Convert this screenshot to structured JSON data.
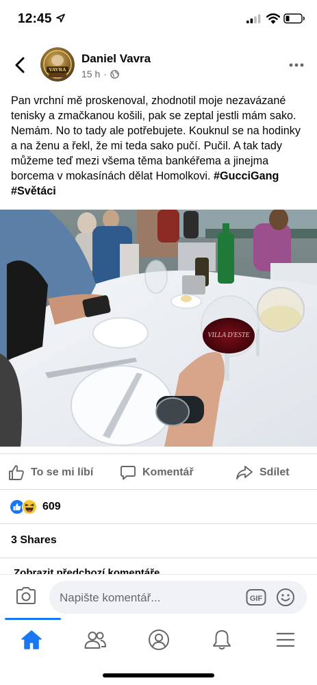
{
  "status_bar": {
    "time": "12:45"
  },
  "post": {
    "author": "Daniel Vavra",
    "avatar_text": "VAVRA",
    "time_ago": "15 h",
    "separator": "·",
    "body_text": "Pan vrchní mě proskenoval, zhodnotil moje nezavázané tenisky a zmačkanou košili, pak se zeptal jestli mám sako. Nemám. No to tady ale potřebujete. Kouknul se na hodinky a na ženu a řekl, že mi teda sako pučí. Pučil. A tak tady můžeme teď mezi všema těma bankéřema a jinejma borcema v mokasínách dělat Homolkovi.",
    "hashtags": [
      "#GucciGang",
      "#Světáci"
    ],
    "photo_wine_label": "VILLA D'ESTE"
  },
  "actions": {
    "like": "To se mi líbí",
    "comment": "Komentář",
    "share": "Sdílet"
  },
  "reactions": {
    "count": "609"
  },
  "shares": "3 Shares",
  "previous_comments": "Zobrazit předchozí komentáře",
  "composer": {
    "placeholder": "Napište komentář...",
    "gif": "GIF"
  },
  "colors": {
    "accent": "#1877f2",
    "secondary_text": "#65676b",
    "divider": "#dcdde1",
    "input_bg": "#f0f2f5"
  },
  "icons": [
    "location-arrow-icon",
    "signal-icon",
    "wifi-icon",
    "battery-icon",
    "back-arrow-icon",
    "globe-icon",
    "more-icon",
    "like-icon",
    "comment-icon",
    "share-icon",
    "like-reaction-icon",
    "haha-reaction-icon",
    "camera-icon",
    "gif-icon",
    "emoji-icon",
    "home-icon",
    "friends-icon",
    "profile-icon",
    "notifications-icon",
    "menu-icon"
  ]
}
